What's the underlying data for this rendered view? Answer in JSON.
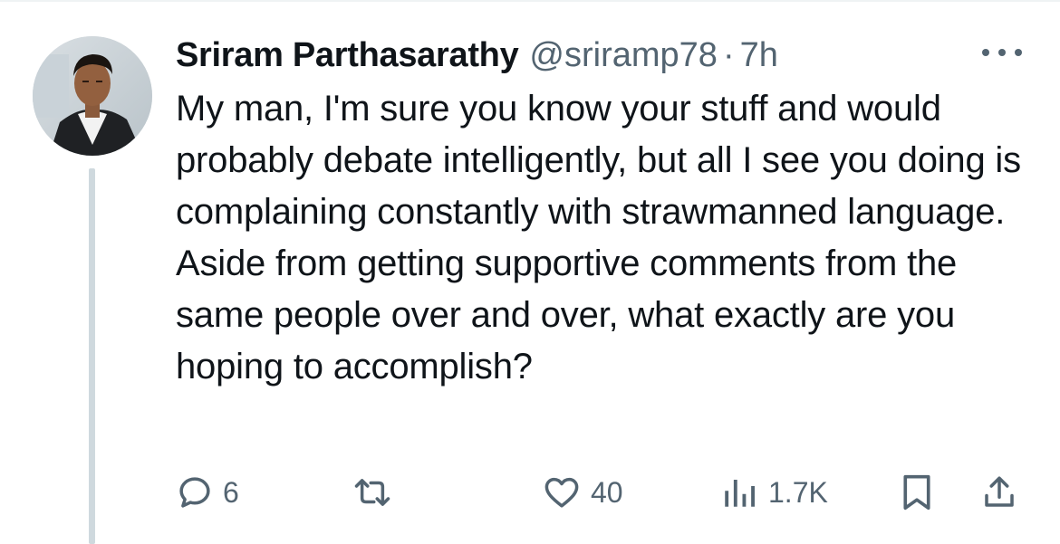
{
  "tweet": {
    "author": {
      "display_name": "Sriram Parthasarathy",
      "handle": "@sriramp78"
    },
    "separator": "·",
    "timestamp": "7h",
    "text": "My man, I'm sure you know your stuff and would probably debate intelligently, but all I see you doing is complaining constantly with strawmanned language. Aside from getting supportive comments from the same people over and over, what exactly are you hoping to accomplish?",
    "metrics": {
      "replies": "6",
      "likes": "40",
      "views": "1.7K"
    }
  },
  "icons": {
    "more": "more-horizontal-icon",
    "reply": "reply-icon",
    "retweet": "retweet-icon",
    "like": "heart-icon",
    "views": "views-chart-icon",
    "bookmark": "bookmark-icon",
    "share": "share-icon"
  },
  "colors": {
    "text_primary": "#0f1419",
    "text_secondary": "#536471",
    "thread_line": "#cfd9de"
  }
}
